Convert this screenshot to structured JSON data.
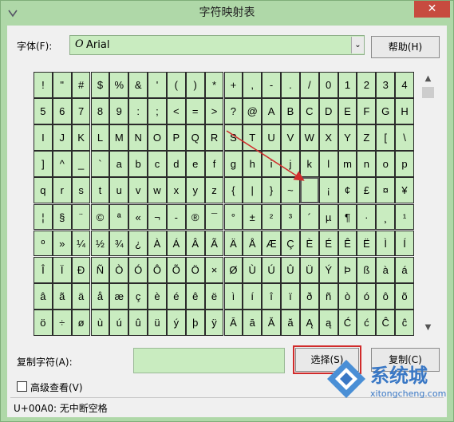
{
  "window": {
    "title": "字符映射表",
    "close_glyph": "✕"
  },
  "font": {
    "label": "字体(F):",
    "glyph": "O",
    "name": "Arial",
    "dropdown_glyph": "⌄"
  },
  "help_label": "帮助(H)",
  "grid": {
    "rows": [
      [
        "!",
        "\"",
        "#",
        "$",
        "%",
        "&",
        "'",
        "(",
        ")",
        "*",
        "+",
        ",",
        "-",
        ".",
        "/",
        "0",
        "1",
        "2",
        "3",
        "4"
      ],
      [
        "5",
        "6",
        "7",
        "8",
        "9",
        ":",
        ";",
        "<",
        "=",
        ">",
        "?",
        "@",
        "A",
        "B",
        "C",
        "D",
        "E",
        "F",
        "G",
        "H"
      ],
      [
        "I",
        "J",
        "K",
        "L",
        "M",
        "N",
        "O",
        "P",
        "Q",
        "R",
        "S",
        "T",
        "U",
        "V",
        "W",
        "X",
        "Y",
        "Z",
        "[",
        "\\"
      ],
      [
        "]",
        "^",
        "_",
        "`",
        "a",
        "b",
        "c",
        "d",
        "e",
        "f",
        "g",
        "h",
        "i",
        "j",
        "k",
        "l",
        "m",
        "n",
        "o",
        "p"
      ],
      [
        "q",
        "r",
        "s",
        "t",
        "u",
        "v",
        "w",
        "x",
        "y",
        "z",
        "{",
        "|",
        "}",
        "~",
        " ",
        "¡",
        "¢",
        "£",
        "¤",
        "¥"
      ],
      [
        "¦",
        "§",
        "¨",
        "©",
        "ª",
        "«",
        "¬",
        "-",
        "®",
        "¯",
        "°",
        "±",
        "²",
        "³",
        "´",
        "µ",
        "¶",
        "·",
        "¸",
        "¹"
      ],
      [
        "º",
        "»",
        "¼",
        "½",
        "¾",
        "¿",
        "À",
        "Á",
        "Â",
        "Ã",
        "Ä",
        "Å",
        "Æ",
        "Ç",
        "È",
        "É",
        "Ê",
        "Ë",
        "Ì",
        "Í"
      ],
      [
        "Î",
        "Ï",
        "Ð",
        "Ñ",
        "Ò",
        "Ó",
        "Ô",
        "Õ",
        "Ö",
        "×",
        "Ø",
        "Ù",
        "Ú",
        "Û",
        "Ü",
        "Ý",
        "Þ",
        "ß",
        "à",
        "á"
      ],
      [
        "â",
        "ã",
        "ä",
        "å",
        "æ",
        "ç",
        "è",
        "é",
        "ê",
        "ë",
        "ì",
        "í",
        "î",
        "ï",
        "ð",
        "ñ",
        "ò",
        "ó",
        "ô",
        "õ"
      ],
      [
        "ö",
        "÷",
        "ø",
        "ù",
        "ú",
        "û",
        "ü",
        "ý",
        "þ",
        "ÿ",
        "Ā",
        "ā",
        "Ă",
        "ă",
        "Ą",
        "ą",
        "Ć",
        "ć",
        "Ĉ",
        "ĉ"
      ]
    ],
    "selected": {
      "row": 4,
      "col": 14
    }
  },
  "scroll": {
    "up_glyph": "▲",
    "down_glyph": "▼"
  },
  "copy": {
    "label": "复制字符(A):",
    "value": "",
    "select_label": "选择(S)",
    "copy_label": "复制(C)"
  },
  "advanced": {
    "label": "高级查看(V)"
  },
  "status": {
    "text": "U+00A0: 无中断空格"
  },
  "watermark": {
    "brand": "系统城",
    "url": "xitongcheng.com"
  },
  "colors": {
    "accent_green": "#afd8a8",
    "cell_green": "#c9ecc0",
    "highlight_red": "#d12b2b",
    "close_red": "#c74b3f"
  }
}
